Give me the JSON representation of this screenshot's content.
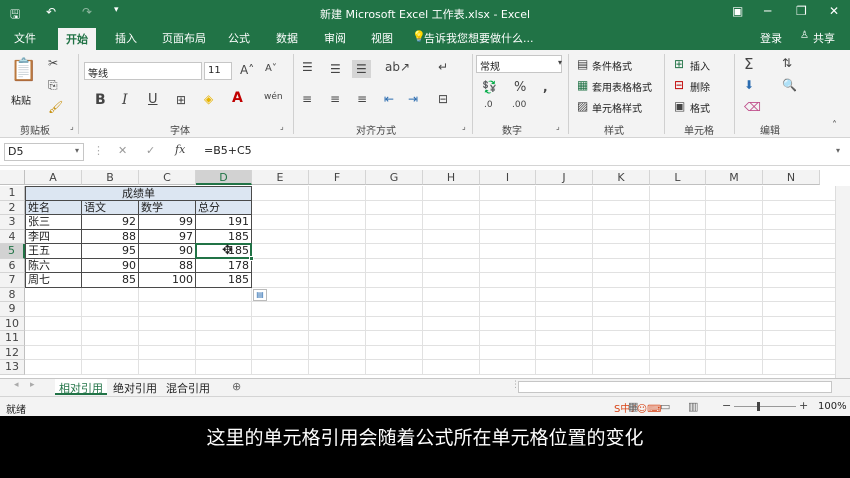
{
  "window": {
    "title": "新建 Microsoft Excel 工作表.xlsx - Excel"
  },
  "tabs": [
    "文件",
    "开始",
    "插入",
    "页面布局",
    "公式",
    "数据",
    "审阅",
    "视图"
  ],
  "tell_me": "告诉我您想要做什么...",
  "login": "登录",
  "share": "共享",
  "ribbon": {
    "paste": "粘贴",
    "font_name": "等线",
    "font_size": "11",
    "number_format": "常规",
    "conditional_format": "条件格式",
    "table_format": "套用表格格式",
    "cell_style": "单元格样式",
    "insert": "插入",
    "delete": "删除",
    "format": "格式",
    "groups": [
      "剪贴板",
      "字体",
      "对齐方式",
      "数字",
      "样式",
      "单元格",
      "编辑"
    ]
  },
  "formula_bar": {
    "name_box": "D5",
    "formula": "=B5+C5"
  },
  "columns": [
    "A",
    "B",
    "C",
    "D",
    "E",
    "F",
    "G",
    "H",
    "I",
    "J",
    "K",
    "L",
    "M",
    "N"
  ],
  "rows": [
    "1",
    "2",
    "3",
    "4",
    "5",
    "6",
    "7",
    "8",
    "9",
    "10",
    "11",
    "12",
    "13"
  ],
  "sheet": {
    "title": "成绩单",
    "headers": [
      "姓名",
      "语文",
      "数学",
      "总分"
    ],
    "data": [
      [
        "张三",
        "92",
        "99",
        "191"
      ],
      [
        "李四",
        "88",
        "97",
        "185"
      ],
      [
        "王五",
        "95",
        "90",
        "185"
      ],
      [
        "陈六",
        "90",
        "88",
        "178"
      ],
      [
        "周七",
        "85",
        "100",
        "185"
      ]
    ]
  },
  "sheet_tabs": [
    "相对引用",
    "绝对引用",
    "混合引用"
  ],
  "status": {
    "mode": "就绪",
    "zoom": "100%"
  },
  "subtitle": "这里的单元格引用会随着公式所在单元格位置的变化"
}
